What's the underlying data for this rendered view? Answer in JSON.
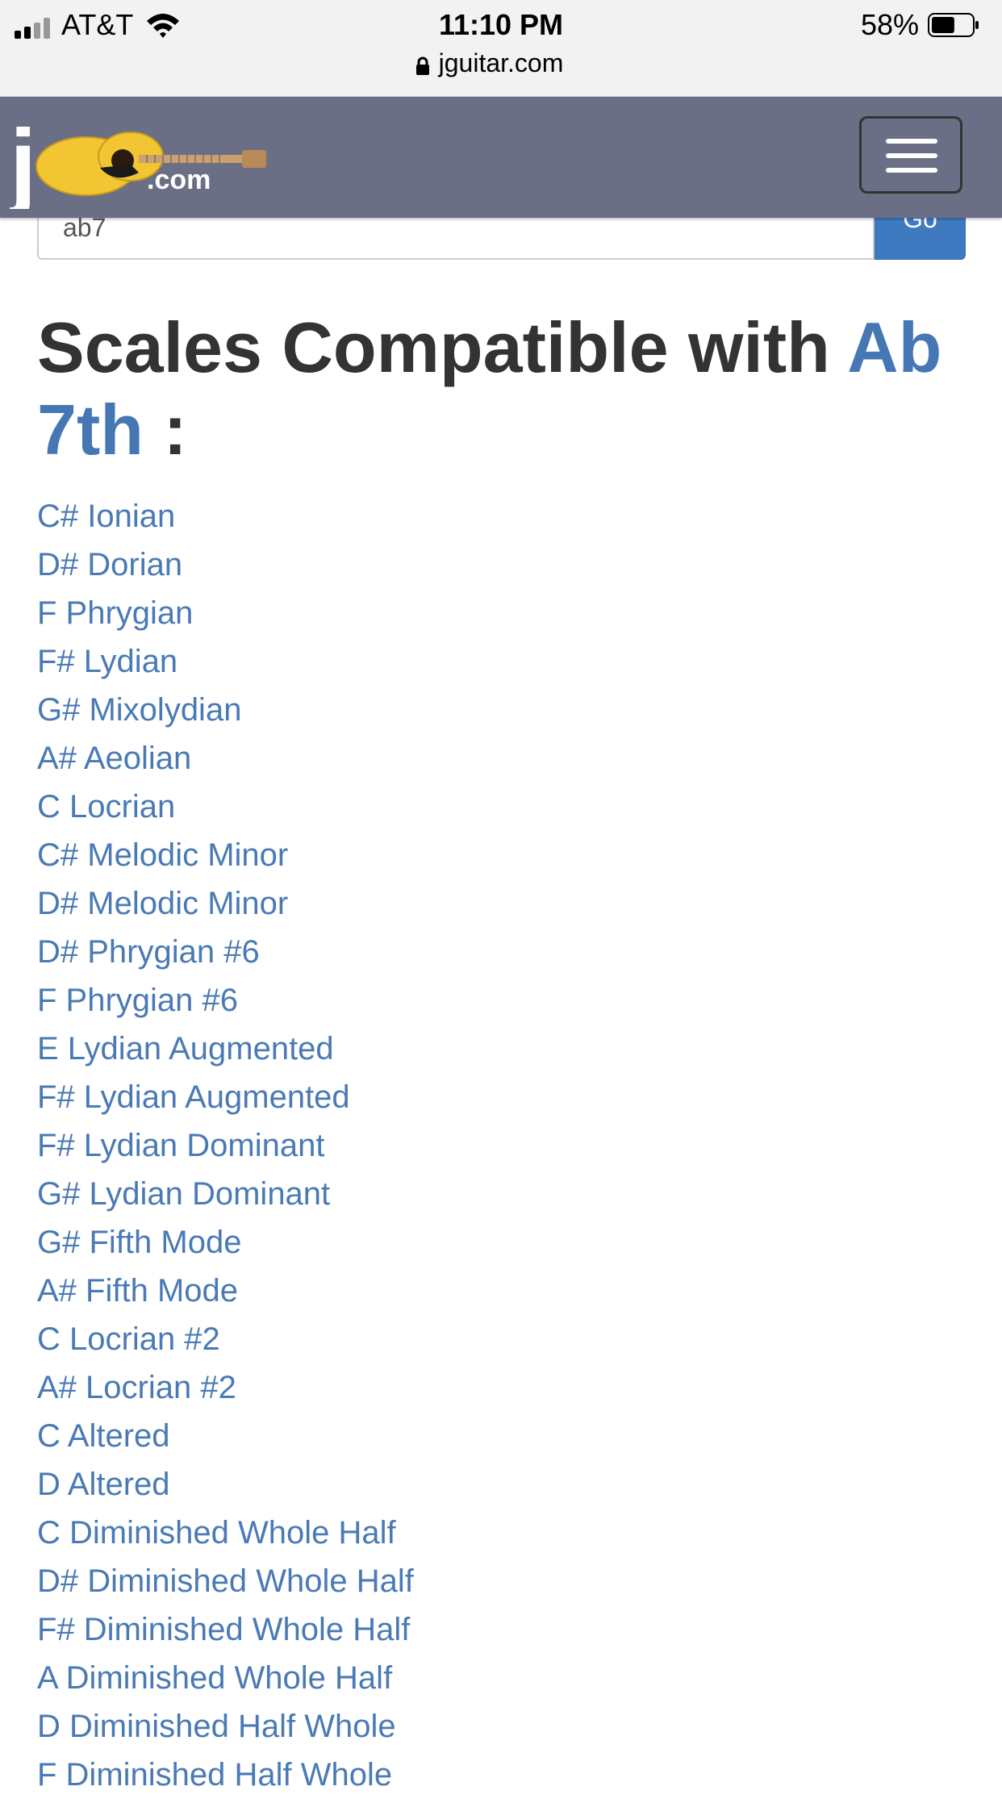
{
  "status_bar": {
    "carrier": "AT&T",
    "time": "11:10 PM",
    "battery_percent": "58%",
    "url": "jguitar.com",
    "battery_level": 0.58
  },
  "navbar": {
    "logo_text": ".com",
    "logo_letter": "j",
    "background": "#6a6f86"
  },
  "search": {
    "value": "ab7",
    "button_label": "Go"
  },
  "page_title": {
    "prefix": "Scales Compatible with ",
    "chord": "Ab 7th",
    "suffix": " :"
  },
  "scales": [
    "C# Ionian",
    "D# Dorian",
    "F Phrygian",
    "F# Lydian",
    "G# Mixolydian",
    "A# Aeolian",
    "C Locrian",
    "C# Melodic Minor",
    "D# Melodic Minor",
    "D# Phrygian #6",
    "F Phrygian #6",
    "E Lydian Augmented",
    "F# Lydian Augmented",
    "F# Lydian Dominant",
    "G# Lydian Dominant",
    "G# Fifth Mode",
    "A# Fifth Mode",
    "C Locrian #2",
    "A# Locrian #2",
    "C Altered",
    "D Altered",
    "C Diminished Whole Half",
    "D# Diminished Whole Half",
    "F# Diminished Whole Half",
    "A Diminished Whole Half",
    "D Diminished Half Whole",
    "F Diminished Half Whole"
  ],
  "colors": {
    "link": "#4a7ab5",
    "heading": "#333333",
    "go_button": "#3f7ac1"
  }
}
